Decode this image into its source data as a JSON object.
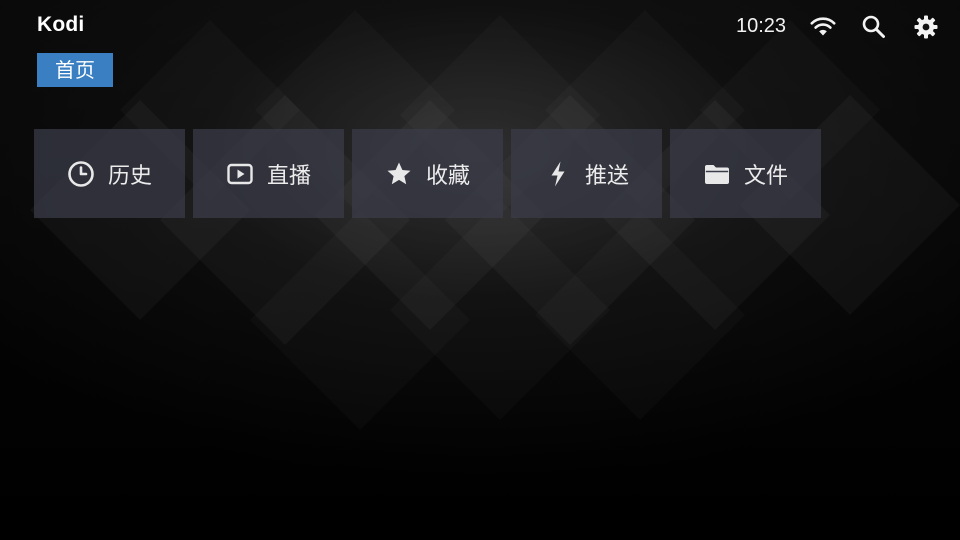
{
  "app": {
    "title": "Kodi"
  },
  "breadcrumb": {
    "label": "首页"
  },
  "status": {
    "time": "10:23",
    "icons": [
      "wifi-icon",
      "search-icon",
      "gear-icon"
    ]
  },
  "menu": {
    "items": [
      {
        "label": "历史",
        "icon": "clock-icon"
      },
      {
        "label": "直播",
        "icon": "play-icon"
      },
      {
        "label": "收藏",
        "icon": "star-icon"
      },
      {
        "label": "推送",
        "icon": "lightning-icon"
      },
      {
        "label": "文件",
        "icon": "folder-icon"
      }
    ]
  },
  "colors": {
    "accent": "#3a7fc1",
    "tile": "#3a3c4a",
    "background": "#000000"
  }
}
